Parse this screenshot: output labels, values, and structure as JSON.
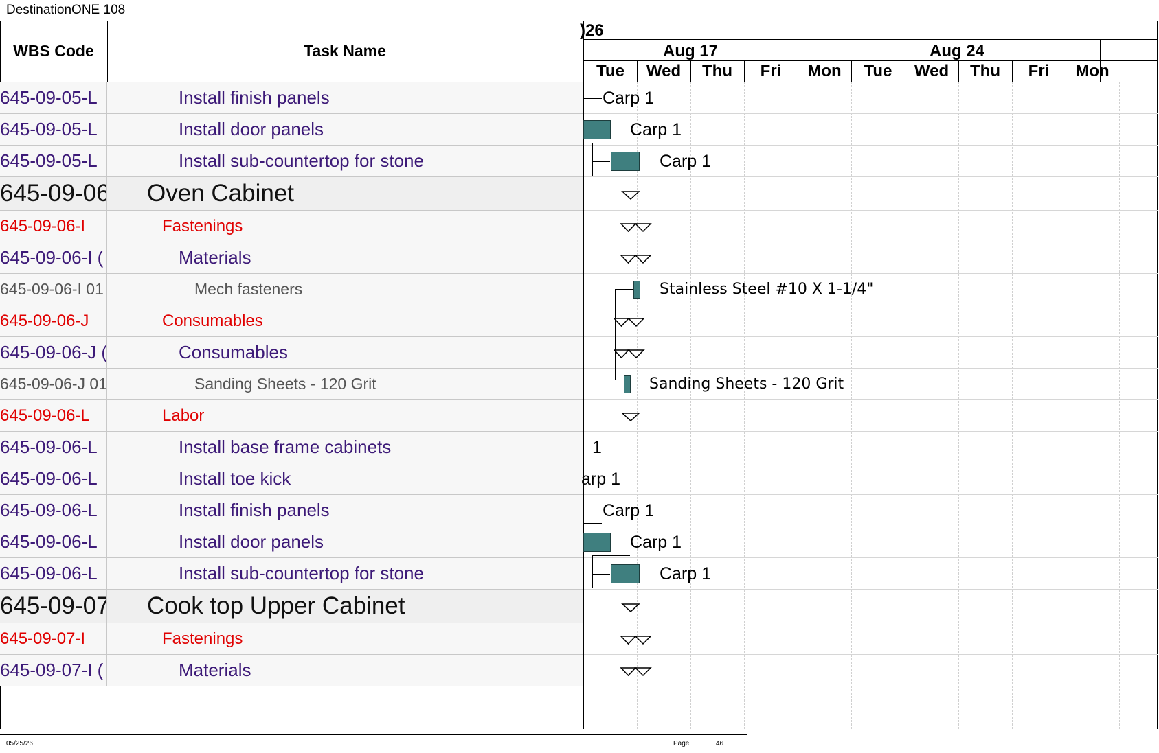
{
  "page_title": "DestinationONE 108",
  "table": {
    "col_wbs": "WBS Code",
    "col_task": "Task Name",
    "rows": [
      {
        "wbs": "645-09-05-L",
        "task": "Install finish panels",
        "level": "p"
      },
      {
        "wbs": "645-09-05-L",
        "task": "Install door panels",
        "level": "p"
      },
      {
        "wbs": "645-09-05-L",
        "task": "Install sub-countertop for stone",
        "level": "p"
      },
      {
        "wbs": "645-09-06",
        "task": "Oven Cabinet",
        "level": "h"
      },
      {
        "wbs": "645-09-06-I",
        "task": "Fastenings",
        "level": "r"
      },
      {
        "wbs": "645-09-06-I (",
        "task": "Materials",
        "level": "p"
      },
      {
        "wbs": "645-09-06-I 01",
        "task": "Mech fasteners",
        "level": "g"
      },
      {
        "wbs": "645-09-06-J",
        "task": "Consumables",
        "level": "r"
      },
      {
        "wbs": "645-09-06-J (",
        "task": "Consumables",
        "level": "p"
      },
      {
        "wbs": "645-09-06-J 01",
        "task": "Sanding Sheets - 120 Grit",
        "level": "g"
      },
      {
        "wbs": "645-09-06-L",
        "task": "Labor",
        "level": "r"
      },
      {
        "wbs": "645-09-06-L",
        "task": "Install base frame cabinets",
        "level": "p"
      },
      {
        "wbs": "645-09-06-L",
        "task": "Install toe kick",
        "level": "p"
      },
      {
        "wbs": "645-09-06-L",
        "task": "Install finish panels",
        "level": "p"
      },
      {
        "wbs": "645-09-06-L",
        "task": "Install door panels",
        "level": "p"
      },
      {
        "wbs": "645-09-06-L",
        "task": "Install sub-countertop for stone",
        "level": "p"
      },
      {
        "wbs": "645-09-07",
        "task": "Cook top Upper Cabinet",
        "level": "h"
      },
      {
        "wbs": "645-09-07-I",
        "task": "Fastenings",
        "level": "r"
      },
      {
        "wbs": "645-09-07-I (",
        "task": "Materials",
        "level": "p"
      }
    ]
  },
  "gantt": {
    "year_fragment": ")26",
    "weeks": [
      "Aug 17",
      "Aug 24"
    ],
    "days": [
      "Tue",
      "Wed",
      "Thu",
      "Fri",
      "Mon",
      "Tue",
      "Wed",
      "Thu",
      "Fri",
      "Mon"
    ],
    "labels": {
      "carp": "Carp 1",
      "carp_partial": "arp 1",
      "one": "1",
      "stainless": "Stainless Steel #10 X 1-1/4\"",
      "sanding": "Sanding Sheets - 120 Grit"
    },
    "bar_color": "#3f7f7f"
  },
  "footer": {
    "date": "05/25/26",
    "page_label": "Page",
    "page_number": "46"
  }
}
